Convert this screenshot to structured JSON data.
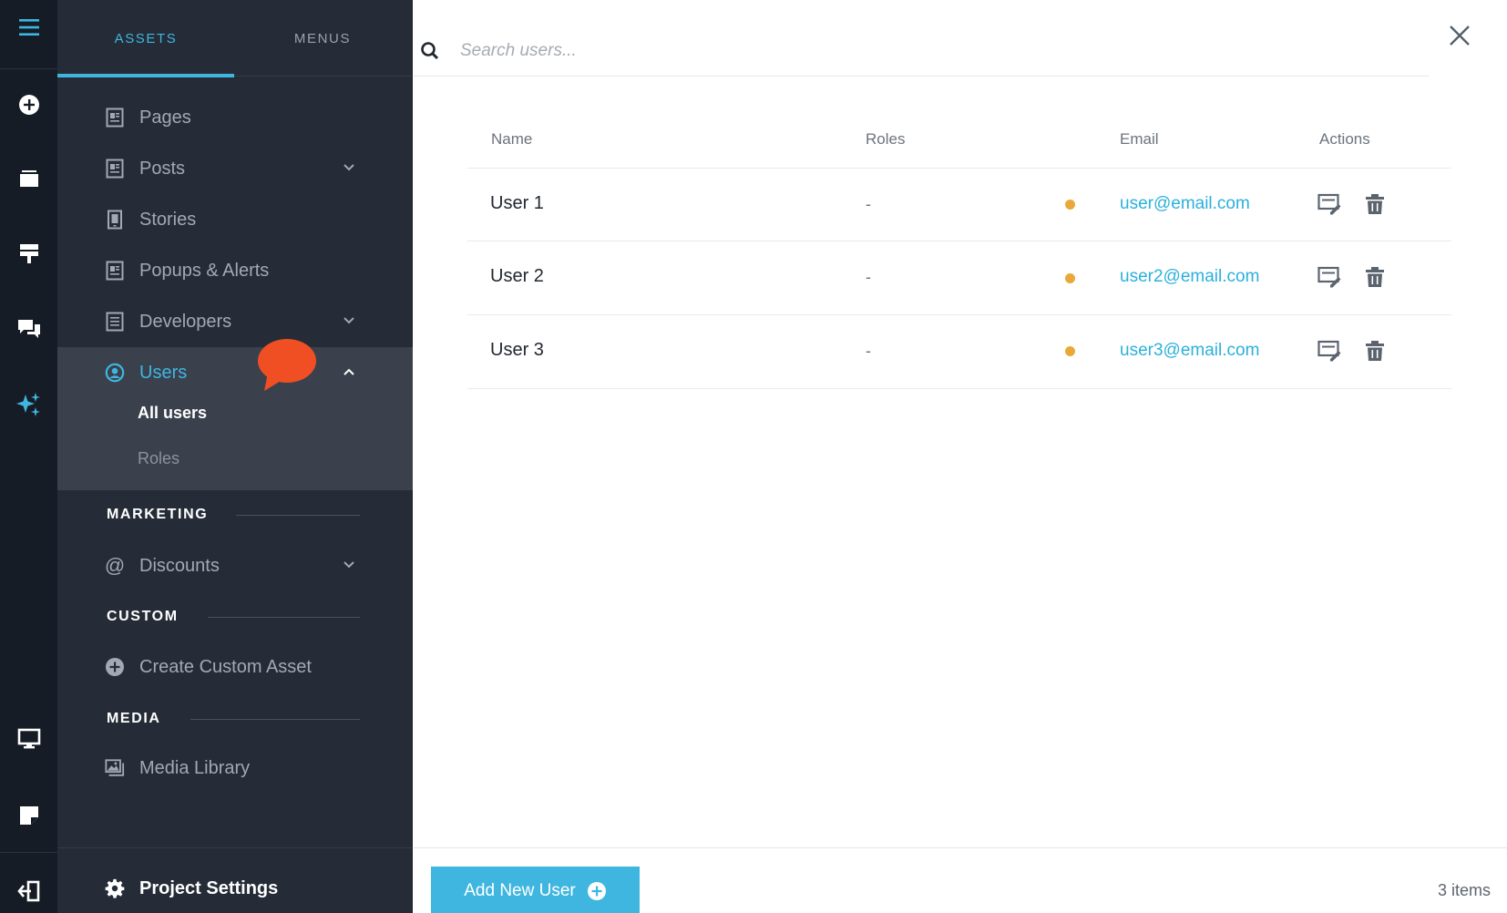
{
  "rail": {
    "items": [
      "menu-icon",
      "add-circle-icon",
      "layers-icon",
      "paint-roller-icon",
      "chat-icon",
      "sparkles-icon",
      "monitor-icon",
      "note-icon",
      "exit-icon"
    ]
  },
  "sidebar": {
    "tabs": [
      {
        "label": "ASSETS",
        "active": true
      },
      {
        "label": "MENUS",
        "active": false
      }
    ],
    "items": [
      {
        "label": "Pages",
        "icon": "page-icon"
      },
      {
        "label": "Posts",
        "icon": "page-icon",
        "expandable": true
      },
      {
        "label": "Stories",
        "icon": "phone-icon"
      },
      {
        "label": "Popups & Alerts",
        "icon": "page-icon"
      },
      {
        "label": "Developers",
        "icon": "page-icon",
        "expandable": true
      },
      {
        "label": "Users",
        "icon": "user-circle-icon",
        "expanded": true
      }
    ],
    "users_sub": [
      {
        "label": "All users",
        "active": true
      },
      {
        "label": "Roles",
        "active": false
      }
    ],
    "sections": {
      "marketing": "MARKETING",
      "custom": "CUSTOM",
      "media": "MEDIA"
    },
    "discounts": {
      "label": "Discounts",
      "icon": "at-icon"
    },
    "create_custom": {
      "label": "Create Custom Asset",
      "icon": "add-circle-icon"
    },
    "media_library": {
      "label": "Media Library",
      "icon": "images-icon"
    },
    "project_settings": {
      "label": "Project Settings",
      "icon": "gear-icon"
    }
  },
  "search": {
    "placeholder": "Search users..."
  },
  "table": {
    "columns": [
      "Name",
      "Roles",
      "Email",
      "Actions"
    ],
    "rows": [
      {
        "name": "User 1",
        "role": "-",
        "email": "user@email.com"
      },
      {
        "name": "User 2",
        "role": "-",
        "email": "user2@email.com"
      },
      {
        "name": "User 3",
        "role": "-",
        "email": "user3@email.com"
      }
    ]
  },
  "footer": {
    "add_button": "Add New User",
    "items_count": "3 items"
  },
  "colors": {
    "accent": "#3fb6e0",
    "status": "#e9a93a",
    "notification": "#f04e23",
    "rail_bg": "#161c26",
    "sidebar_bg": "#252c37"
  }
}
